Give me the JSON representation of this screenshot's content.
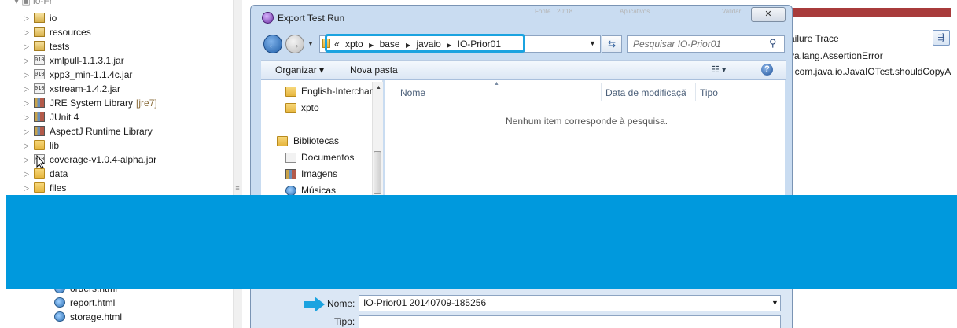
{
  "tree": {
    "items": [
      {
        "label": "io",
        "icon": "package-folder-icon"
      },
      {
        "label": "resources",
        "icon": "package-folder-icon"
      },
      {
        "label": "tests",
        "icon": "package-folder-icon"
      },
      {
        "label": "xmlpull-1.1.3.1.jar",
        "icon": "jar-icon"
      },
      {
        "label": "xpp3_min-1.1.4c.jar",
        "icon": "jar-icon"
      },
      {
        "label": "xstream-1.4.2.jar",
        "icon": "jar-icon"
      },
      {
        "label": "JRE System Library",
        "suffix": "[jre7]",
        "icon": "library-icon"
      },
      {
        "label": "JUnit 4",
        "icon": "library-icon"
      },
      {
        "label": "AspectJ Runtime Library",
        "icon": "library-icon"
      },
      {
        "label": "lib",
        "icon": "folder-icon"
      },
      {
        "label": "coverage-v1.0.4-alpha.jar",
        "icon": "jar-icon"
      },
      {
        "label": "data",
        "icon": "folder-icon"
      },
      {
        "label": "files",
        "icon": "folder-icon"
      }
    ],
    "bottom_items": [
      {
        "label": "orders.html",
        "icon": "globe-icon"
      },
      {
        "label": "report.html",
        "icon": "globe-icon"
      },
      {
        "label": "storage.html",
        "icon": "globe-icon"
      }
    ]
  },
  "junit": {
    "title": "ailure Trace",
    "trace": [
      "va.lang.AssertionError",
      "t com.java.io.JavaIOTest.shouldCopyA"
    ]
  },
  "dialog": {
    "title": "Export Test Run",
    "close": "✕",
    "breadcrumbs": [
      "«",
      "xpto",
      "base",
      "javaio",
      "IO-Prior01"
    ],
    "search_placeholder": "Pesquisar IO-Prior01",
    "toolbar": {
      "organize": "Organizar ▾",
      "new_folder": "Nova pasta",
      "view": "☷ ▾",
      "help": "?"
    },
    "nav_items": [
      {
        "label": "English-Interchar",
        "icon": "folder-icon"
      },
      {
        "label": "xpto",
        "icon": "folder-icon"
      },
      {
        "label": "Bibliotecas",
        "icon": "libraries-icon"
      },
      {
        "label": "Documentos",
        "icon": "documents-icon"
      },
      {
        "label": "Imagens",
        "icon": "pictures-icon"
      },
      {
        "label": "Músicas",
        "icon": "music-icon"
      }
    ],
    "columns": [
      "Nome",
      "Data de modificaçã",
      "Tipo"
    ],
    "empty_message": "Nenhum item corresponde à pesquisa.",
    "name_label": "Nome:",
    "name_value": "IO-Prior01 20140709-185256",
    "type_label": "Tipo:"
  },
  "colors": {
    "banner": "#0099dd",
    "highlight": "#1ba3e0",
    "junit_failure_bar": "#a83b3b"
  }
}
